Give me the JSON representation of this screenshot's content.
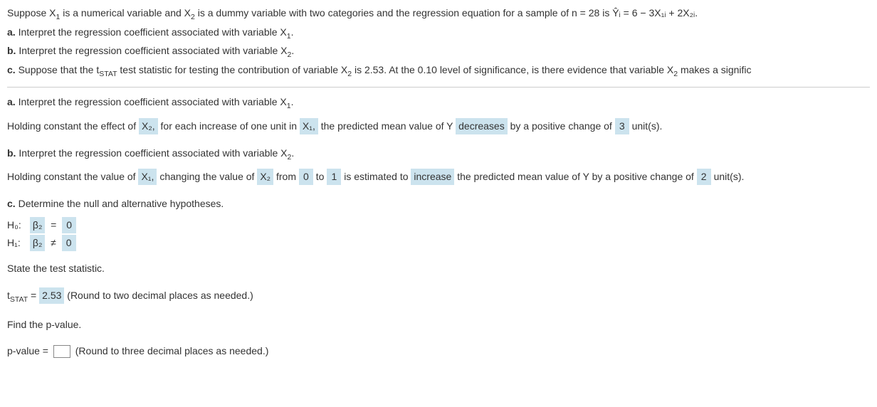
{
  "problem": {
    "intro_prefix": "Suppose X",
    "intro_sub1": "1",
    "intro_mid1": " is a numerical variable and X",
    "intro_sub2": "2",
    "intro_mid2": " is a dummy variable with two categories and the regression equation for a sample of n = 28 is ",
    "equation": "Ŷᵢ = 6 − 3X₁ᵢ + 2X₂ᵢ.",
    "a_label": "a.",
    "a_text": "Interpret the regression coefficient associated with variable X",
    "a_sub": "1",
    "a_end": ".",
    "b_label": "b.",
    "b_text": "Interpret the regression coefficient associated with variable X",
    "b_sub": "2",
    "b_end": ".",
    "c_label": "c.",
    "c_prefix": "Suppose that the t",
    "c_stat_sub": "STAT",
    "c_mid1": " test statistic for testing the contribution of variable X",
    "c_x2sub": "2",
    "c_mid2": " is 2.53. At the 0.10 level of significance, is there evidence that variable X",
    "c_mid3": " makes a signific"
  },
  "partA": {
    "heading_label": "a.",
    "heading_text": " Interpret the regression coefficient associated with variable X",
    "heading_sub": "1",
    "heading_end": ".",
    "t1": "Holding constant the effect of ",
    "ans1": "X₂,",
    "t2": " for each increase of one unit in ",
    "ans2": "X₁,",
    "t3": " the predicted mean value of Y ",
    "ans3": "decreases",
    "t4": " by a positive change of ",
    "ans4": "3",
    "t5": " unit(s)."
  },
  "partB": {
    "heading_label": "b.",
    "heading_text": " Interpret the regression coefficient associated with variable X",
    "heading_sub": "2",
    "heading_end": ".",
    "t1": "Holding constant the value of ",
    "ans1": "X₁,",
    "t2": " changing the value of ",
    "ans2": "X₂",
    "t3": " from ",
    "ans3": "0",
    "t4": " to ",
    "ans4": "1",
    "t5": " is estimated to ",
    "ans5": "increase",
    "t6": " the predicted mean value of Y by a positive change of ",
    "ans6": "2",
    "t7": " unit(s)."
  },
  "partC": {
    "heading_label": "c.",
    "heading_text": " Determine the null and alternative hypotheses.",
    "h0_label": "H₀:",
    "h0_param": "β₂",
    "h0_op": "=",
    "h0_val": "0",
    "h1_label": "H₁:",
    "h1_param": "β₂",
    "h1_op": "≠",
    "h1_val": "0",
    "state_stat": "State the test statistic.",
    "tstat_label_pre": "t",
    "tstat_label_sub": "STAT",
    "tstat_label_post": " = ",
    "tstat_val": "2.53",
    "tstat_hint": " (Round to two decimal places as needed.)",
    "find_pval": "Find the p-value.",
    "pval_label": "p-value = ",
    "pval_hint": " (Round to three decimal places as needed.)"
  }
}
